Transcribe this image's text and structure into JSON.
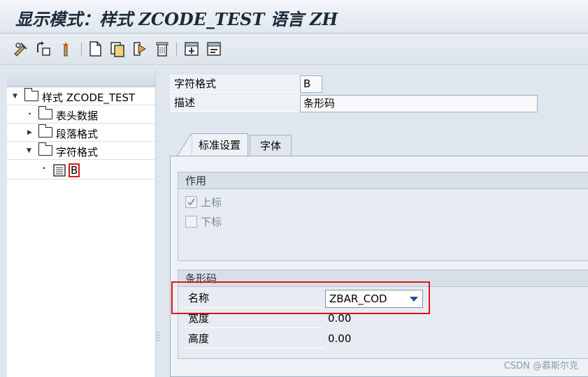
{
  "window": {
    "title": "显示模式：样式 ZCODE_TEST 语言 ZH"
  },
  "toolbar": {
    "icons": [
      "display-change-icon",
      "activate-icon",
      "wand-icon",
      "new-doc-icon",
      "copy-icon",
      "check-icon",
      "delete-icon",
      "expand-icon",
      "collapse-icon"
    ]
  },
  "tree": {
    "root": "样式 ZCODE_TEST",
    "items": [
      {
        "label": "表头数据"
      },
      {
        "label": "段落格式"
      },
      {
        "label": "字符格式"
      }
    ],
    "leaf": "B"
  },
  "header_fields": {
    "char_format_label": "字符格式",
    "char_format_value": "B",
    "desc_label": "描述",
    "desc_value": "条形码"
  },
  "tabs": [
    {
      "label": "标准设置",
      "active": true
    },
    {
      "label": "字体",
      "active": false
    }
  ],
  "effect_group": {
    "title": "作用",
    "superscript_label": "上标",
    "superscript_checked": true,
    "subscript_label": "下标",
    "subscript_checked": false
  },
  "barcode_group": {
    "title": "条形码",
    "name_label": "名称",
    "name_value": "ZBAR_COD",
    "width_label": "宽度",
    "width_value": "0.00",
    "height_label": "高度",
    "height_value": "0.00"
  },
  "watermark": "CSDN @慕斯尔克",
  "colors": {
    "accent": "#e01414",
    "panel": "#eef2f6",
    "border": "#9fb0c1"
  }
}
